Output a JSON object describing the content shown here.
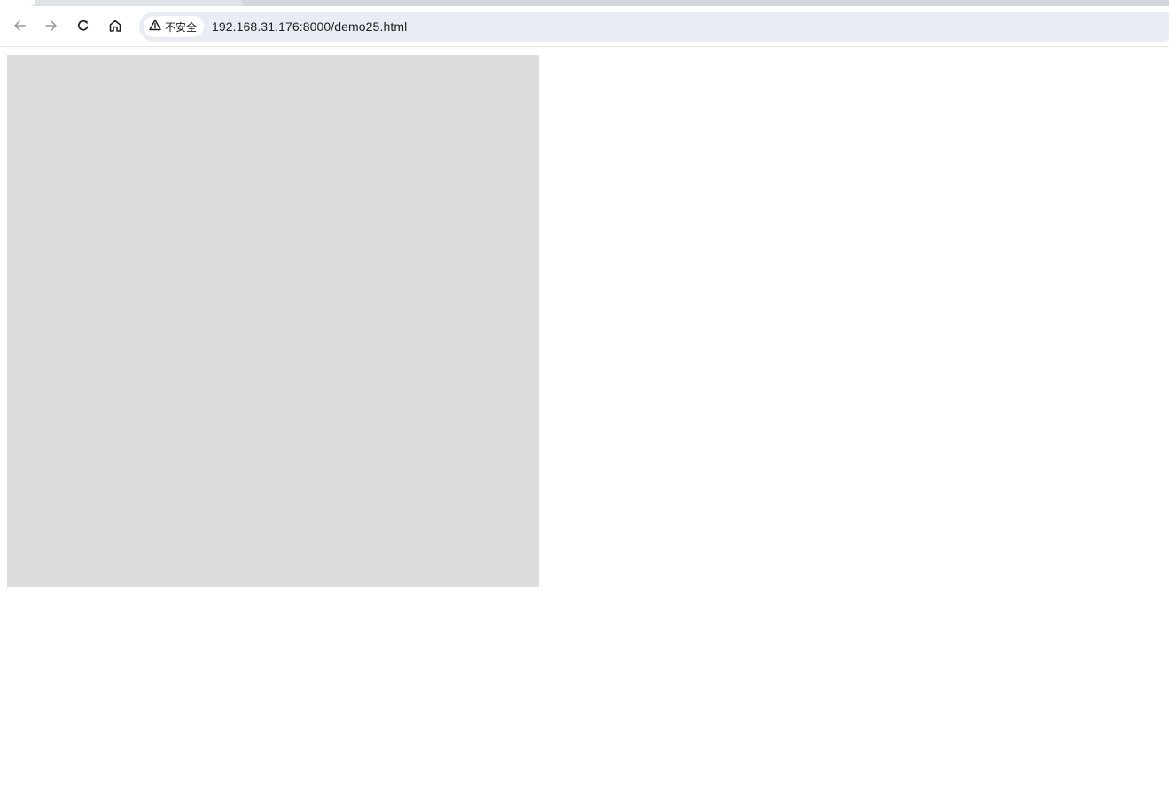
{
  "browser": {
    "toolbar": {
      "back_icon": "arrow-left-icon",
      "forward_icon": "arrow-right-icon",
      "reload_icon": "reload-icon",
      "home_icon": "home-icon"
    },
    "omnibox": {
      "security_icon": "warning-triangle-icon",
      "security_label": "不安全",
      "url": "192.168.31.176:8000/demo25.html"
    }
  },
  "page": {
    "box": {
      "color": "#dcdcdc"
    }
  }
}
